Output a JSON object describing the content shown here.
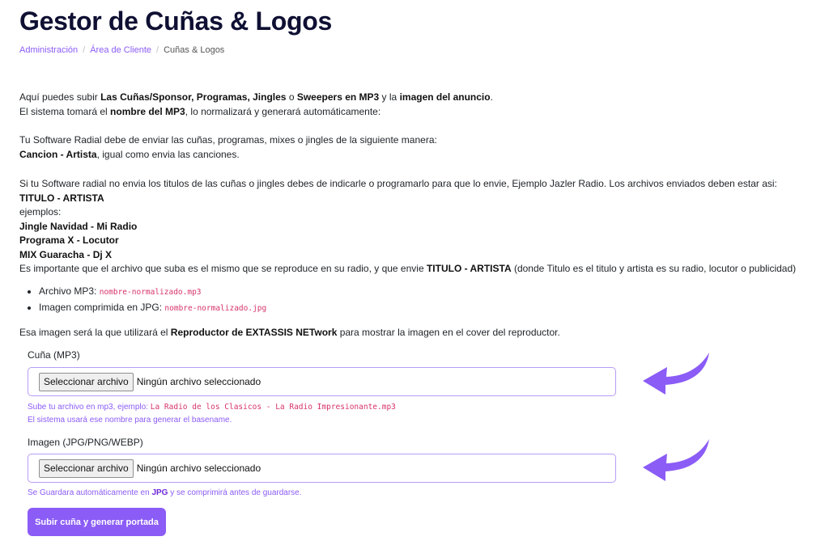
{
  "page": {
    "title": "Gestor de Cuñas & Logos"
  },
  "breadcrumb": {
    "items": [
      "Administración",
      "Área de Cliente",
      "Cuñas & Logos"
    ],
    "separator": "/"
  },
  "intro": {
    "l1_a": "Aquí puedes subir ",
    "l1_b": "Las Cuñas/Sponsor, Programas, Jingles",
    "l1_c": " o ",
    "l1_d": "Sweepers en MP3",
    "l1_e": " y la ",
    "l1_f": "imagen del anuncio",
    "l1_g": ".",
    "l2_a": "El sistema tomará el ",
    "l2_b": "nombre del MP3",
    "l2_c": ", lo normalizará y generará automáticamente:",
    "l3": "Tu Software Radial debe de enviar las cuñas, programas, mixes o jingles de la siguiente manera:",
    "l4_a": "Cancion - Artista",
    "l4_b": ", igual como envia las canciones.",
    "l5_a": "Si tu Software radial no envia los titulos de las cuñas o jingles debes de indicarle o programarlo para que lo envie, Ejemplo Jazler Radio. Los archivos enviados deben estar asi: ",
    "l5_b": "TITULO - ARTISTA",
    "l6": "ejemplos:",
    "ex1": "Jingle Navidad - Mi Radio",
    "ex2": "Programa X - Locutor",
    "ex3": "MIX Guaracha - Dj X",
    "l7_a": "Es importante que el archivo que suba es el mismo que se reproduce en su radio, y que envie ",
    "l7_b": "TITULO - ARTISTA",
    "l7_c": " (donde Titulo es el titulo y artista es su radio, locutor o publicidad)",
    "li1_label": "Archivo MP3: ",
    "li1_code": "nombre-normalizado.mp3",
    "li2_label": "Imagen comprimida en JPG: ",
    "li2_code": "nombre-normalizado.jpg",
    "l8_a": "Esa imagen será la que utilizará el ",
    "l8_b": "Reproductor de EXTASSIS NETwork",
    "l8_c": " para mostrar la imagen en el cover del reproductor."
  },
  "form": {
    "mp3": {
      "label": "Cuña (MP3)",
      "button": "Seleccionar archivo",
      "status": "Ningún archivo seleccionado",
      "help1_a": "Sube tu archivo en mp3, ejemplo: ",
      "help1_code": "La Radio de los Clasicos - La Radio Impresionante.mp3",
      "help2": "El sistema usará ese nombre para generar el basename."
    },
    "image": {
      "label": "Imagen (JPG/PNG/WEBP)",
      "button": "Seleccionar archivo",
      "status": "Ningún archivo seleccionado",
      "help_a": "Se Guardara automáticamente en ",
      "help_b": "JPG",
      "help_c": " y se comprimirá antes de guardarse."
    },
    "submit": "Subir cuña y generar portada"
  },
  "colors": {
    "accent": "#8b5cf6",
    "title": "#0f1033",
    "code": "#d6336c"
  },
  "icons": {
    "arrow": "curved-arrow-left-icon"
  }
}
